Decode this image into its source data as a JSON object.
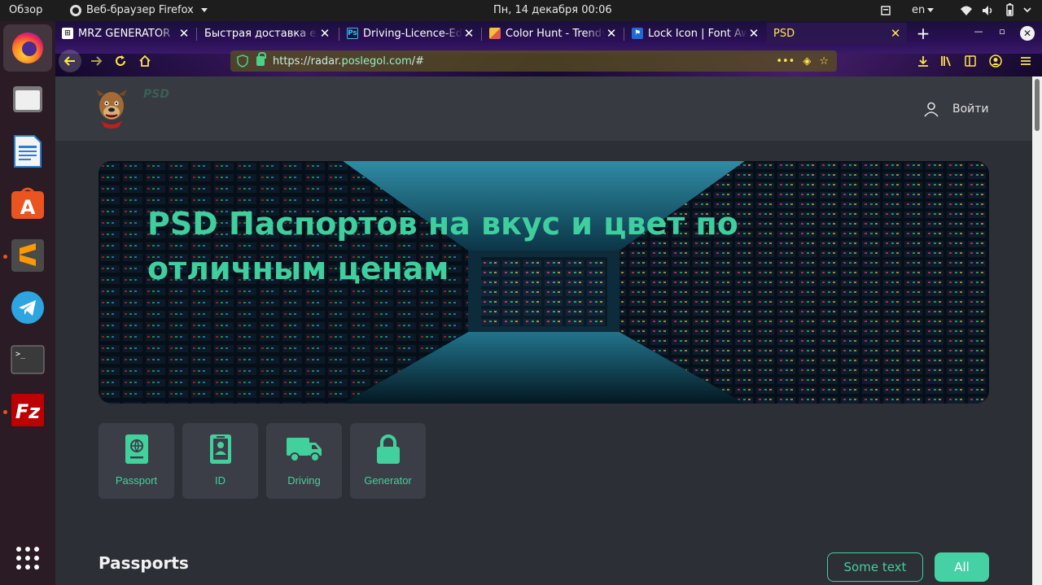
{
  "system_bar": {
    "activities": "Обзор",
    "app_name": "Веб-браузер Firefox",
    "clock": "Пн, 14 декабря  00:06",
    "language": "en"
  },
  "dock": {
    "apps": [
      "firefox-icon",
      "files-icon",
      "writer-icon",
      "software-center-icon",
      "sublime-text-icon",
      "telegram-icon",
      "terminal-icon",
      "filezilla-icon"
    ]
  },
  "tabs": [
    {
      "title": "MRZ GENERATOR",
      "favicon": "mrz-favicon"
    },
    {
      "title": "Быстрая доставка еды",
      "favicon": ""
    },
    {
      "title": "Driving-Licence-Editable",
      "favicon": "photoshop-favicon"
    },
    {
      "title": "Color Hunt - Trendy",
      "favicon": "colorhunt-favicon"
    },
    {
      "title": "Lock Icon | Font Awesome",
      "favicon": "flag-favicon"
    },
    {
      "title": "PSD",
      "favicon": ""
    }
  ],
  "url": {
    "scheme": "https://",
    "host_prefix": "radar.",
    "host": "poslegol.com",
    "path": "/#"
  },
  "site": {
    "brand": "PSD",
    "login": "Войти"
  },
  "hero": {
    "title": "PSD Паспортов на вкус и цвет по отличным ценам"
  },
  "categories": [
    {
      "label": "Passport",
      "icon": "passport-icon"
    },
    {
      "label": "ID",
      "icon": "id-card-icon"
    },
    {
      "label": "Driving",
      "icon": "truck-icon"
    },
    {
      "label": "Generator",
      "icon": "lock-icon"
    }
  ],
  "section": {
    "title": "Passports",
    "filter_outline": "Some text",
    "filter_all": "All"
  },
  "colors": {
    "accent": "#41d19c",
    "page_bg": "#2c2f36",
    "card_bg": "#3b3e46"
  }
}
